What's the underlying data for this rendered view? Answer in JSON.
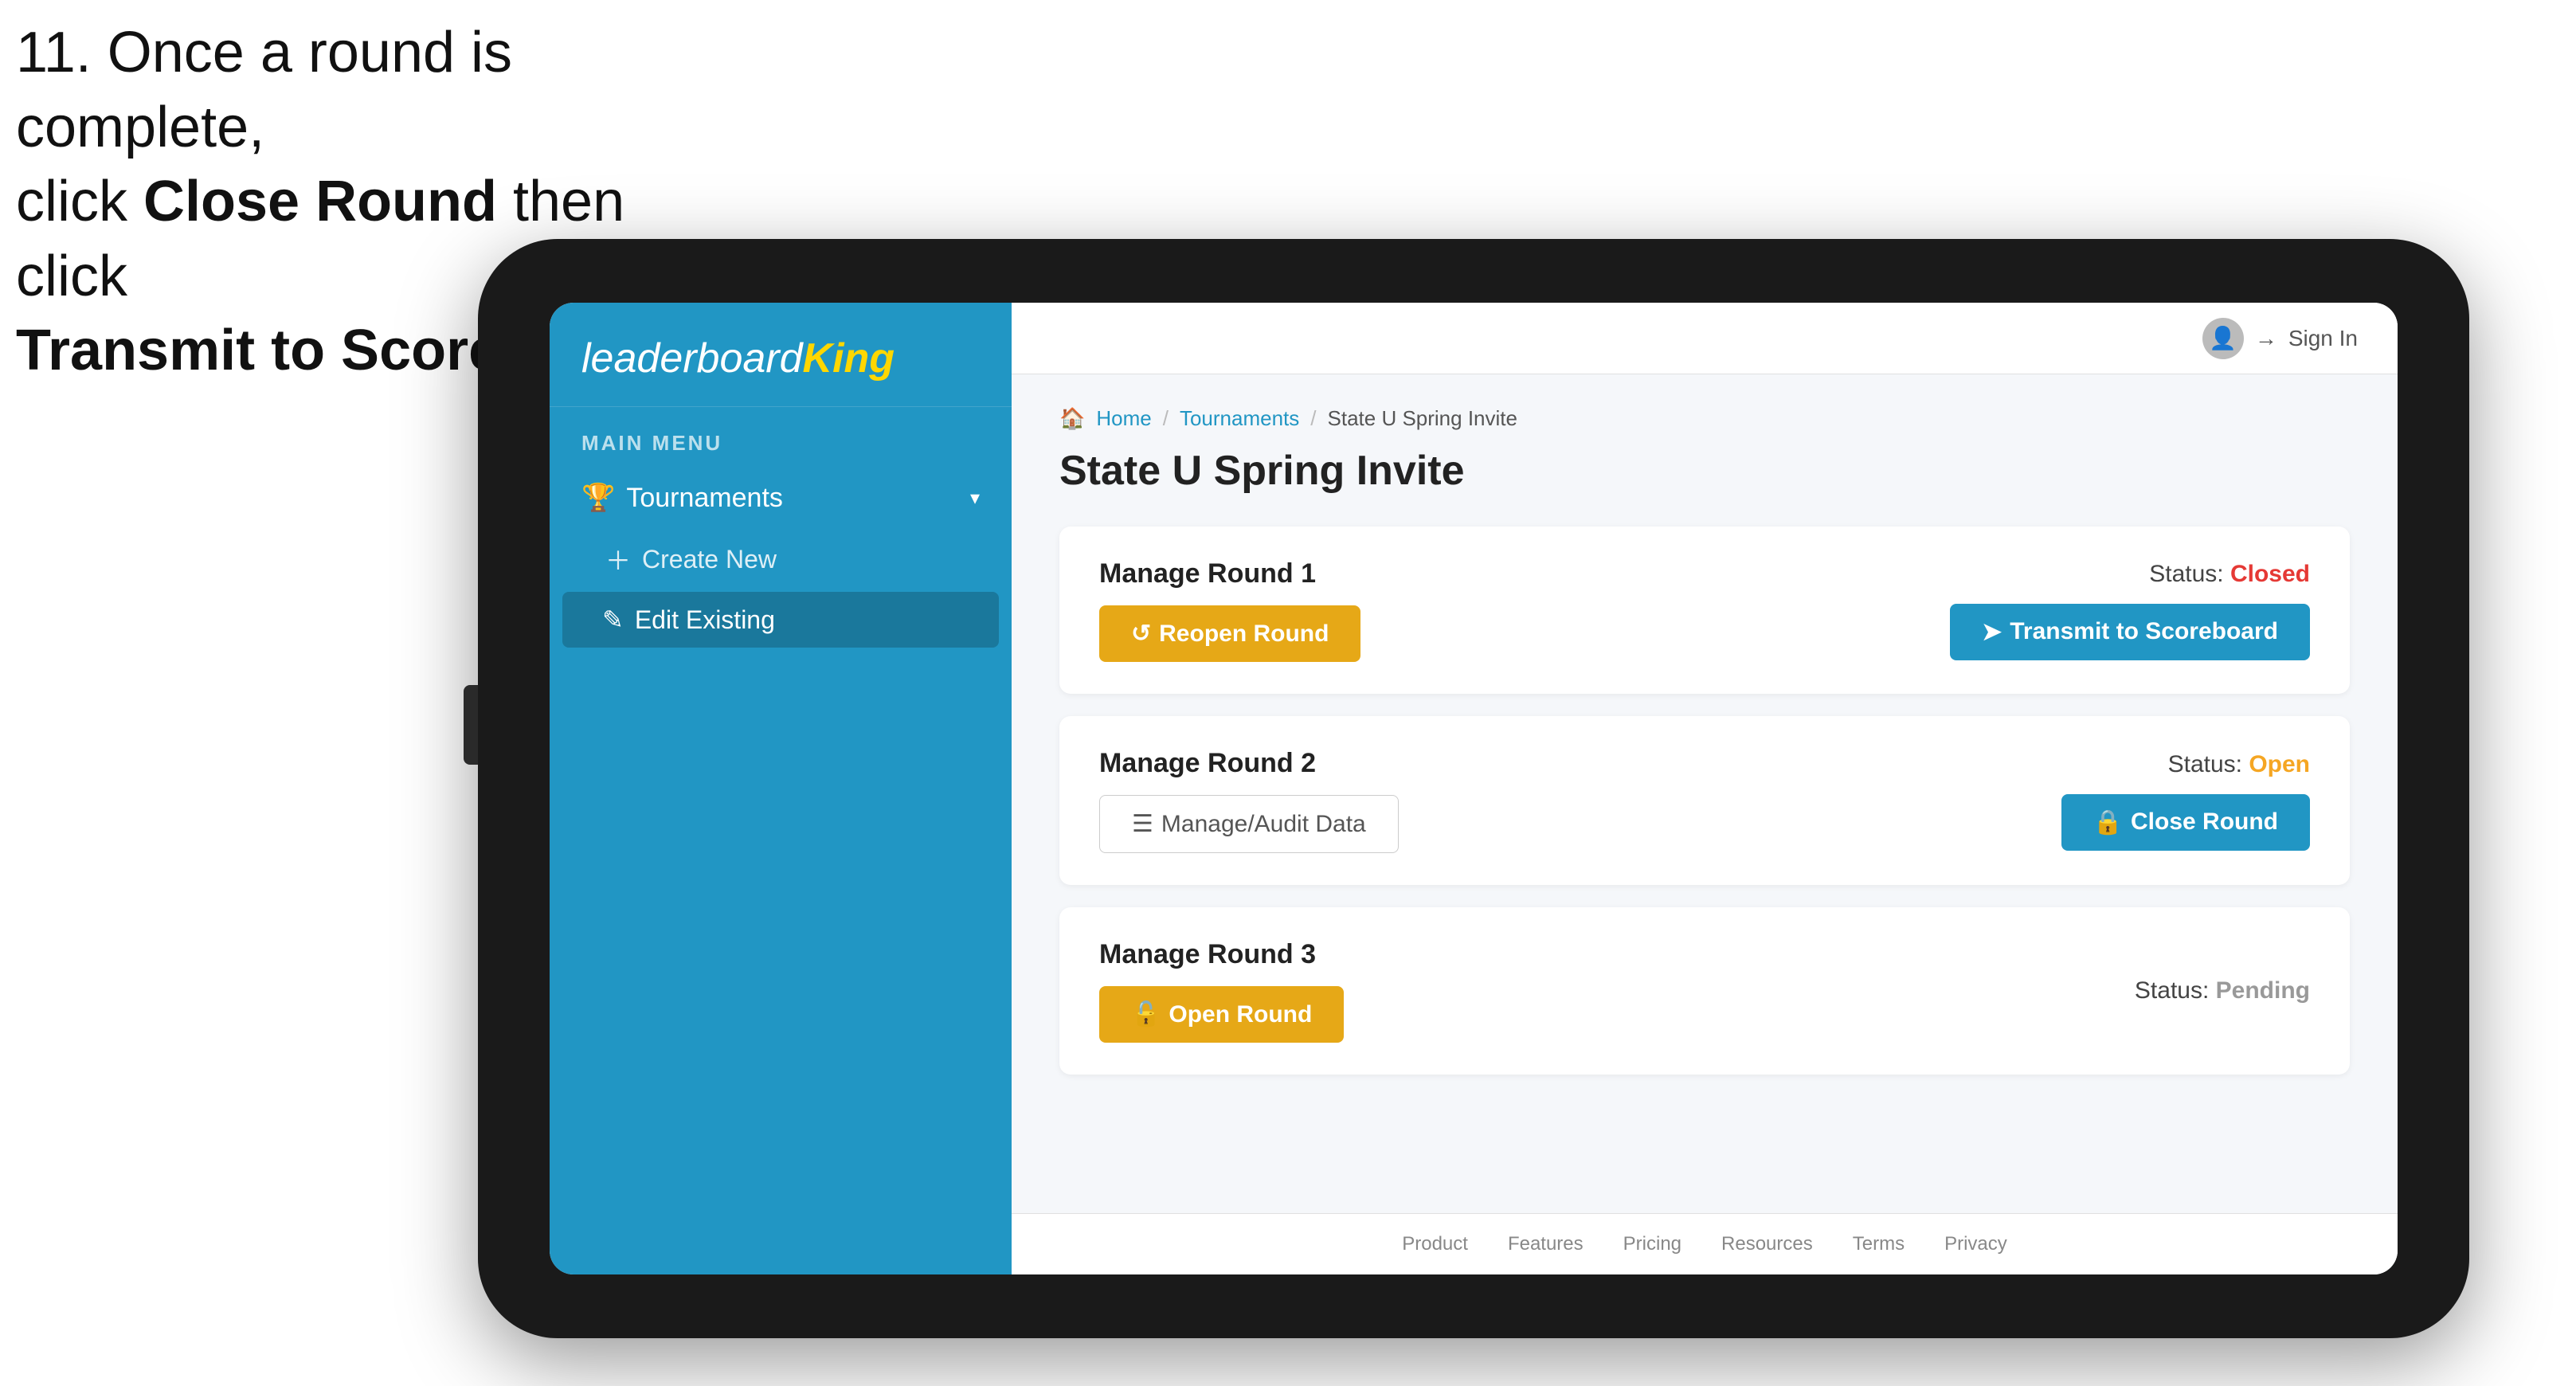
{
  "instruction": {
    "line1": "11. Once a round is complete,",
    "line2_prefix": "click ",
    "line2_bold": "Close Round",
    "line2_suffix": " then click",
    "line3": "Transmit to Scoreboard."
  },
  "tablet": {
    "logo": {
      "leaderboard": "leaderboard",
      "king": "King"
    },
    "sidebar": {
      "main_menu_label": "MAIN MENU",
      "items": [
        {
          "label": "Tournaments",
          "icon": "trophy",
          "expanded": true
        }
      ],
      "sub_items": [
        {
          "label": "Create New",
          "icon": "plus",
          "active": false
        },
        {
          "label": "Edit Existing",
          "icon": "edit",
          "active": true
        }
      ]
    },
    "topbar": {
      "sign_in_label": "Sign In"
    },
    "breadcrumb": {
      "home": "Home",
      "tournaments": "Tournaments",
      "current": "State U Spring Invite"
    },
    "page_title": "State U Spring Invite",
    "rounds": [
      {
        "title": "Manage Round 1",
        "status_label": "Status:",
        "status_value": "Closed",
        "status_type": "closed",
        "buttons": [
          {
            "label": "Reopen Round",
            "type": "gold",
            "icon": "reopen"
          },
          {
            "label": "Transmit to Scoreboard",
            "type": "blue",
            "icon": "transmit"
          }
        ]
      },
      {
        "title": "Manage Round 2",
        "status_label": "Status:",
        "status_value": "Open",
        "status_type": "open",
        "buttons": [
          {
            "label": "Manage/Audit Data",
            "type": "outline",
            "icon": "audit"
          },
          {
            "label": "Close Round",
            "type": "blue",
            "icon": "close"
          }
        ]
      },
      {
        "title": "Manage Round 3",
        "status_label": "Status:",
        "status_value": "Pending",
        "status_type": "pending",
        "buttons": [
          {
            "label": "Open Round",
            "type": "gold",
            "icon": "open"
          }
        ]
      }
    ],
    "footer": {
      "links": [
        "Product",
        "Features",
        "Pricing",
        "Resources",
        "Terms",
        "Privacy"
      ]
    }
  }
}
